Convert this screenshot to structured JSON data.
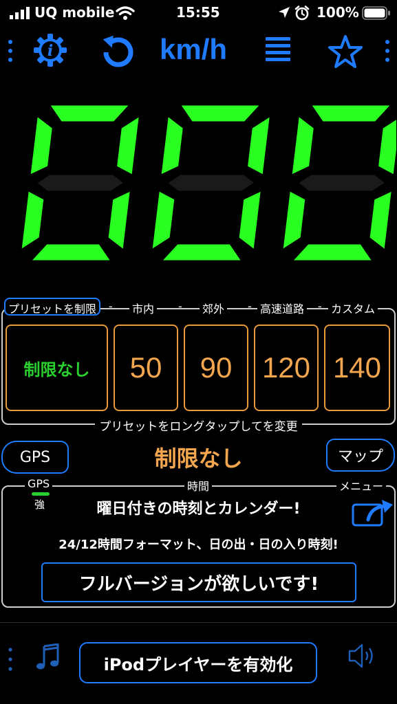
{
  "status_bar": {
    "carrier": "UQ mobile",
    "time": "15:55",
    "battery": "100%"
  },
  "toolbar": {
    "unit": "km/h",
    "icons": [
      "more-vertical-icon",
      "info-gear-icon",
      "reset-icon",
      "unit-label",
      "list-icon",
      "star-icon",
      "more-vertical-icon"
    ]
  },
  "speed": {
    "value": "000",
    "accent": "#2aff22"
  },
  "presets": {
    "title": "プリセットを制限",
    "headers": [
      "市内",
      "郊外",
      "高速道路",
      "カスタム"
    ],
    "separator": "-",
    "buttons": [
      "制限なし",
      "50",
      "90",
      "120",
      "140"
    ],
    "hint": "プリセットをロングタップしてを変更"
  },
  "gps_row": {
    "gps_button": "GPS",
    "current_limit": "制限なし",
    "map_button": "マップ"
  },
  "info_panel": {
    "gps_label": "GPS",
    "gps_strength": "強",
    "gps_level": 1.0,
    "time_label": "時間",
    "menu_label": "メニュー",
    "line1": "曜日付きの時刻とカレンダー!",
    "line2": "24/12時間フォーマット、日の出・日の入り時刻!",
    "full_version": "フルバージョンが欲しいです!"
  },
  "bottom": {
    "ipod_button": "iPodプレイヤーを有効化"
  },
  "colors": {
    "accent_blue": "#1f7bff",
    "preset_orange": "#e89a3c",
    "digit_green": "#2aff22",
    "no_limit_green": "#2ad12e"
  }
}
